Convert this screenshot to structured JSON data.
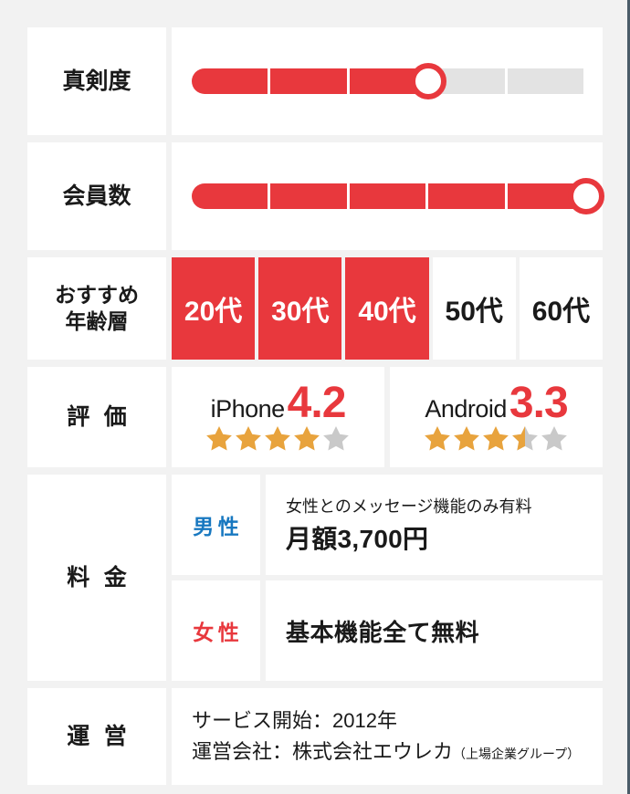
{
  "theme": {
    "accent_red": "#e8383d",
    "star_orange": "#e8a33d",
    "star_gray": "#c9c9c9",
    "male_blue": "#1878c0",
    "background": "#f2f2f2",
    "track_gray": "#e3e3e3"
  },
  "rows": {
    "seriousness": {
      "label": "真剣度",
      "segments": 5,
      "filled": 3,
      "knob_at": 3
    },
    "members": {
      "label": "会員数",
      "segments": 5,
      "filled": 5,
      "knob_at": 5
    },
    "age": {
      "label_line1": "おすすめ",
      "label_line2": "年齢層",
      "cells": [
        {
          "text": "20代",
          "recommended": true
        },
        {
          "text": "30代",
          "recommended": true
        },
        {
          "text": "40代",
          "recommended": true
        },
        {
          "text": "50代",
          "recommended": false
        },
        {
          "text": "60代",
          "recommended": false
        }
      ]
    },
    "rating": {
      "label": "評価",
      "items": [
        {
          "os": "iPhone",
          "score": "4.2",
          "full_stars": 4,
          "half_star": false,
          "total_stars": 5
        },
        {
          "os": "Android",
          "score": "3.3",
          "full_stars": 3,
          "half_star": true,
          "total_stars": 5
        }
      ]
    },
    "fee": {
      "label": "料金",
      "male": {
        "gender": "男性",
        "note": "女性とのメッセージ機能のみ有料",
        "price": "月額3,700円"
      },
      "female": {
        "gender": "女性",
        "note": "基本機能全て無料"
      }
    },
    "operator": {
      "label": "運営",
      "service_start": "サービス開始：2012年",
      "company": "運営会社：株式会社エウレカ",
      "company_suffix": "（上場企業グループ）"
    }
  }
}
